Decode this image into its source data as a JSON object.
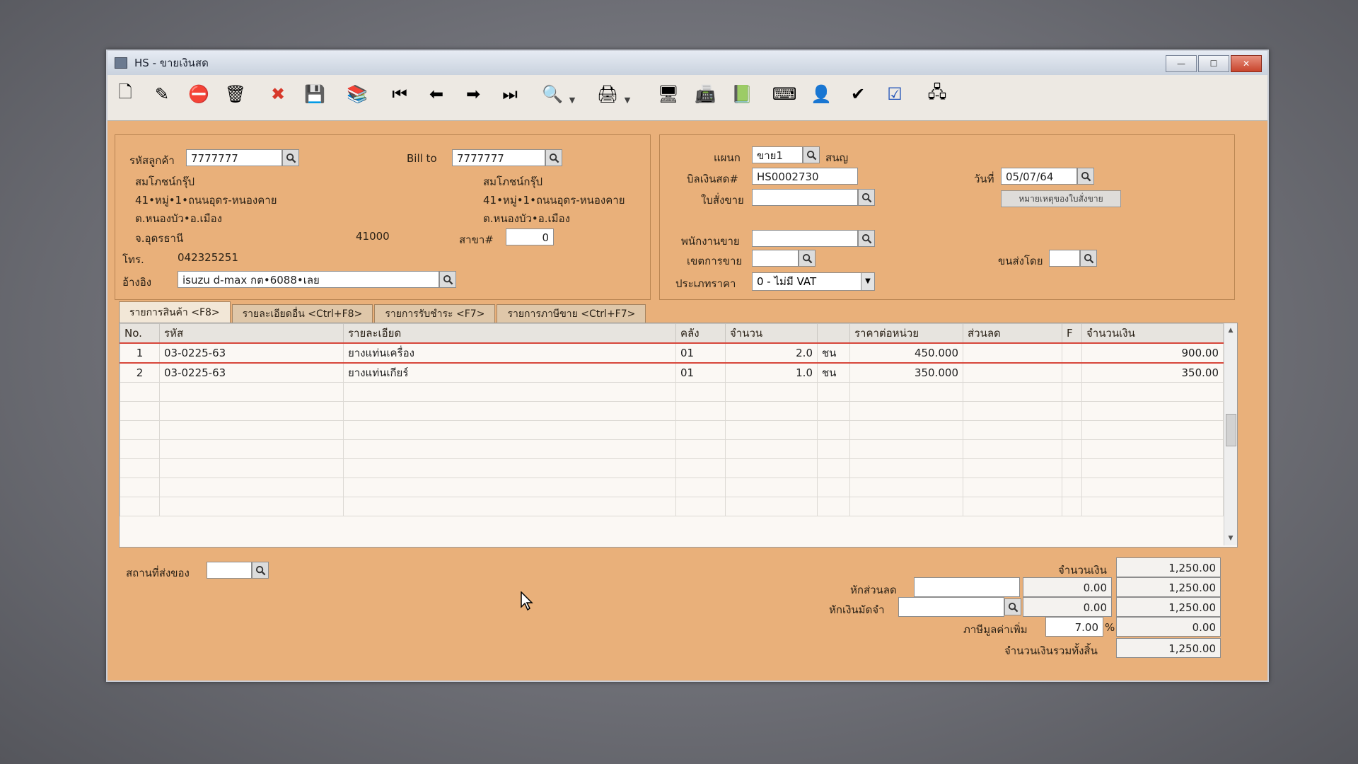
{
  "window": {
    "title": "HS - ขายเงินสด",
    "controls": {
      "minimize": "—",
      "maximize": "☐",
      "close": "✕"
    }
  },
  "toolbar": {
    "buttons": [
      {
        "name": "new-doc-icon",
        "glyph": "🗋"
      },
      {
        "name": "edit-icon",
        "glyph": "✎"
      },
      {
        "name": "void-icon",
        "glyph": "⛔"
      },
      {
        "name": "trash-icon",
        "glyph": "🗑"
      },
      {
        "name": "cancel-icon",
        "glyph": "✖"
      },
      {
        "name": "save-icon",
        "glyph": "💾"
      },
      {
        "name": "books-icon",
        "glyph": "📚"
      },
      {
        "name": "first-record-icon",
        "glyph": "⏮"
      },
      {
        "name": "prev-record-icon",
        "glyph": "⬅"
      },
      {
        "name": "next-record-icon",
        "glyph": "➡"
      },
      {
        "name": "last-record-icon",
        "glyph": "⏭"
      },
      {
        "name": "search-doc-icon",
        "glyph": "🔍"
      },
      {
        "name": "printer-icon",
        "glyph": "🖨"
      },
      {
        "name": "monitor-icon",
        "glyph": "🖥"
      },
      {
        "name": "register-icon",
        "glyph": "📠"
      },
      {
        "name": "so-icon",
        "glyph": "📗"
      },
      {
        "name": "keyin-icon",
        "glyph": "⌨"
      },
      {
        "name": "approve-user-icon",
        "glyph": "👤"
      },
      {
        "name": "approve-ok-icon",
        "glyph": "✔"
      },
      {
        "name": "ok-box-icon",
        "glyph": "☑"
      },
      {
        "name": "network-icon",
        "glyph": "🖧"
      }
    ]
  },
  "customer": {
    "code_label": "รหัสลูกค้า",
    "code_value": "7777777",
    "name": "สมโภชน์กรุ๊ป",
    "address1": "41•หมู่•1•ถนนอุดร-หนองคาย",
    "address2": "ต.หนองบัว•อ.เมือง",
    "province": "จ.อุดรธานี",
    "postcode": "41000",
    "phone_label": "โทร.",
    "phone": "042325251",
    "ref_label": "อ้างอิง",
    "ref_value": "isuzu d-max กต•6088•เลย"
  },
  "bill_to": {
    "label": "Bill to",
    "value": "7777777",
    "name": "สมโภชน์กรุ๊ป",
    "address1": "41•หมู่•1•ถนนอุดร-หนองคาย",
    "address2": "ต.หนองบัว•อ.เมือง",
    "branch_label": "สาขา#",
    "branch_value": "0"
  },
  "doc": {
    "dept_label": "แผนก",
    "dept_value": "ขาย1",
    "dept_name": "สนญ",
    "bill_label": "บิลเงินสด#",
    "bill_value": "HS0002730",
    "date_label": "วันที่",
    "date_value": "05/07/64",
    "so_label": "ใบสั่งขาย",
    "so_value": "",
    "so_note_button": "หมายเหตุของใบสั่งขาย",
    "salesman_label": "พนักงานขาย",
    "salesman_value": "",
    "area_label": "เขตการขาย",
    "area_value": "",
    "ship_by_label": "ขนส่งโดย",
    "ship_by_value": "",
    "price_type_label": "ประเภทราคา",
    "price_type_value": "0 - ไม่มี VAT"
  },
  "tabs": [
    {
      "label": "รายการสินค้า <F8>"
    },
    {
      "label": "รายละเอียดอื่น <Ctrl+F8>"
    },
    {
      "label": "รายการรับชำระ <F7>"
    },
    {
      "label": "รายการภาษีขาย <Ctrl+F7>"
    }
  ],
  "grid": {
    "columns": [
      "No.",
      "รหัส",
      "รายละเอียด",
      "คลัง",
      "จำนวน",
      "",
      "ราคาต่อหน่วย",
      "ส่วนลด",
      "F",
      "จำนวนเงิน"
    ],
    "rows": [
      [
        "1",
        "03-0225-63",
        "ยางแท่นเครื่อง",
        "01",
        "2.0",
        "ชน",
        "450.000",
        "",
        "",
        "900.00"
      ],
      [
        "2",
        "03-0225-63",
        "ยางแท่นเกียร์",
        "01",
        "1.0",
        "ชน",
        "350.000",
        "",
        "",
        "350.00"
      ]
    ],
    "empty_rows": 7
  },
  "footer": {
    "ship_place_label": "สถานที่ส่งของ",
    "ship_place_value": "",
    "amount_label": "จำนวนเงิน",
    "amount_value": "1,250.00",
    "discount_label": "หักส่วนลด",
    "discount_input": "",
    "discount_value": "0.00",
    "after_discount": "1,250.00",
    "deposit_label": "หักเงินมัดจำ",
    "deposit_input": "",
    "deposit_value": "0.00",
    "after_deposit": "1,250.00",
    "vat_label": "ภาษีมูลค่าเพิ่ม",
    "vat_rate": "7.00",
    "vat_percent": "%",
    "vat_value": "0.00",
    "total_label": "จำนวนเงินรวมทั้งสิ้น",
    "total_value": "1,250.00"
  }
}
